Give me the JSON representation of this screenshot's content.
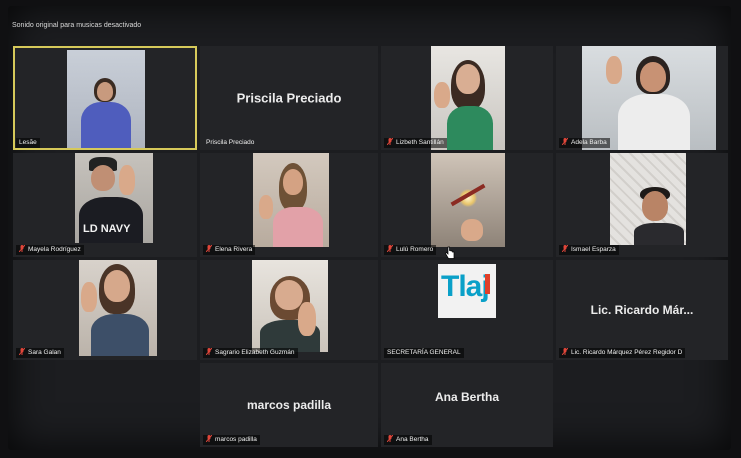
{
  "banner": "Sonido original para musicas desactivado",
  "participants": [
    {
      "name": "Lesãe",
      "tile_name": ""
    },
    {
      "name": "Priscila Preciado",
      "tile_name": "Priscila Preciado"
    },
    {
      "name": "Lizbeth Santillán",
      "tile_name": ""
    },
    {
      "name": "Adela Barba",
      "tile_name": ""
    },
    {
      "name": "Mayela Rodríguez",
      "tile_name": ""
    },
    {
      "name": "Elena Rivera",
      "tile_name": ""
    },
    {
      "name": "Lulú Romero",
      "tile_name": ""
    },
    {
      "name": "Ismael Esparza",
      "tile_name": ""
    },
    {
      "name": "Sara Galan",
      "tile_name": ""
    },
    {
      "name": "Sagrario Elizabeth Guzmán",
      "tile_name": ""
    },
    {
      "name": "SECRETARÍA GENERAL",
      "tile_name": ""
    },
    {
      "name": "Lic. Ricardo Márquez Pérez Regidor D",
      "tile_name": "Lic. Ricardo Már..."
    },
    {
      "name": "marcos padilla",
      "tile_name": "marcos padilla"
    },
    {
      "name": "Ana Bertha",
      "tile_name": "Ana Bertha"
    }
  ],
  "shirt_text": "LD NAVY",
  "logo_text": "Tlaj",
  "colors": {
    "tile_bg": "#232427",
    "active_border": "#d6c95a",
    "muted_mic": "#e0463a",
    "logo_blue": "#0aa0c8"
  }
}
